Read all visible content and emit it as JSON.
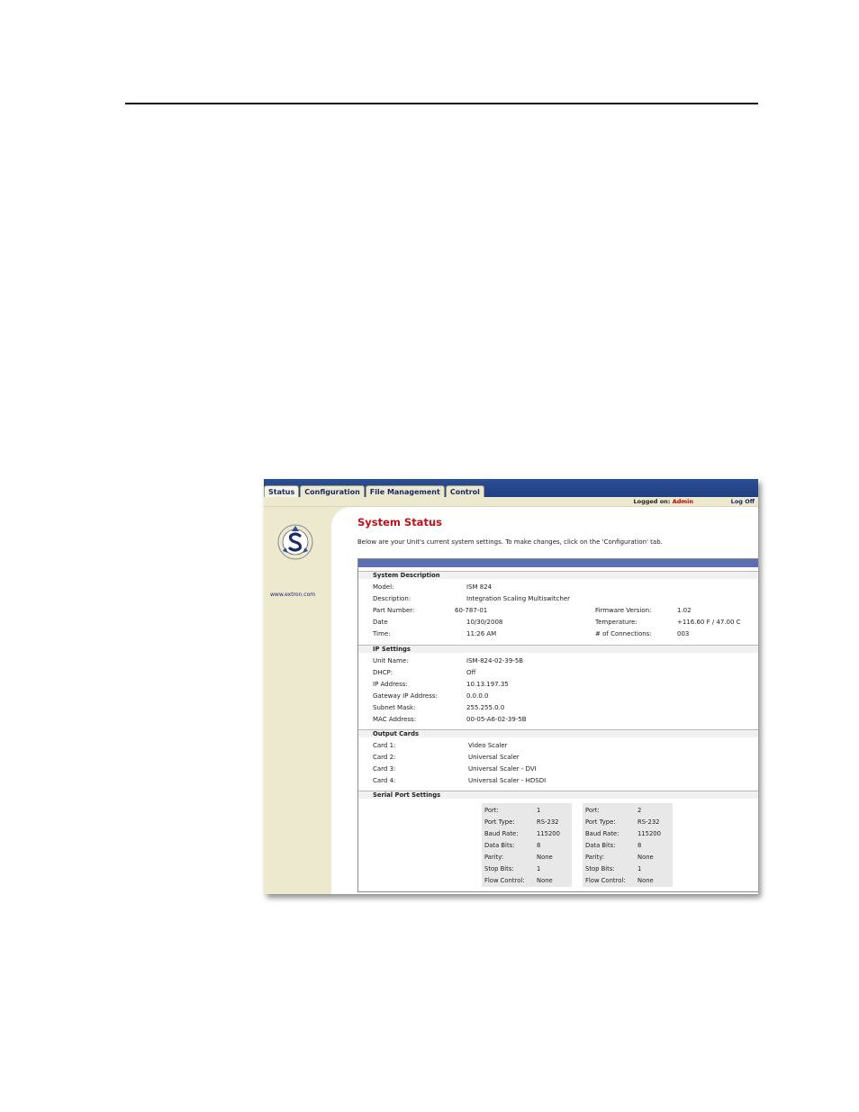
{
  "tabs": [
    "Status",
    "Configuration",
    "File Management",
    "Control"
  ],
  "header": {
    "logged_label": "Logged on:",
    "logged_user": "Admin",
    "logoff": "Log Off"
  },
  "sidebar": {
    "logo_url": "www.extron.com"
  },
  "main": {
    "title": "System Status",
    "intro": "Below are your Unit's current system settings. To make changes, click on the 'Configuration' tab."
  },
  "system_description": {
    "heading": "System Description",
    "left": [
      {
        "label": "Model:",
        "value": "ISM 824"
      },
      {
        "label": "Description:",
        "value": "Integration Scaling Multiswitcher"
      },
      {
        "label": "Part Number:",
        "value": "60-787-01"
      },
      {
        "label": "Date",
        "value": "10/30/2008"
      },
      {
        "label": "Time:",
        "value": "11:26 AM"
      }
    ],
    "right": [
      {
        "label": "Firmware Version:",
        "value": "1.02"
      },
      {
        "label": "Temperature:",
        "value": "+116.60 F / 47.00 C"
      },
      {
        "label": "# of Connections:",
        "value": "003"
      }
    ]
  },
  "ip_settings": {
    "heading": "IP Settings",
    "rows": [
      {
        "label": "Unit Name:",
        "value": "ISM-824-02-39-5B"
      },
      {
        "label": "DHCP:",
        "value": "Off"
      },
      {
        "label": "IP Address:",
        "value": "10.13.197.35"
      },
      {
        "label": "Gateway IP Address:",
        "value": "0.0.0.0"
      },
      {
        "label": "Subnet Mask:",
        "value": "255.255.0.0"
      },
      {
        "label": "MAC Address:",
        "value": "00-05-A6-02-39-5B"
      }
    ]
  },
  "output_cards": {
    "heading": "Output Cards",
    "rows": [
      {
        "label": "Card 1:",
        "value": "Video Scaler"
      },
      {
        "label": "Card 2:",
        "value": "Universal Scaler"
      },
      {
        "label": "Card 3:",
        "value": "Universal Scaler - DVI"
      },
      {
        "label": "Card 4:",
        "value": "Universal Scaler - HDSDI"
      }
    ]
  },
  "serial_ports": {
    "heading": "Serial Port Settings",
    "ports": [
      {
        "rows": [
          {
            "label": "Port:",
            "value": "1"
          },
          {
            "label": "Port Type:",
            "value": "RS-232"
          },
          {
            "label": "Baud Rate:",
            "value": "115200"
          },
          {
            "label": "Data Bits:",
            "value": "8"
          },
          {
            "label": "Parity:",
            "value": "None"
          },
          {
            "label": "Stop Bits:",
            "value": "1"
          },
          {
            "label": "Flow Control:",
            "value": "None"
          }
        ]
      },
      {
        "rows": [
          {
            "label": "Port:",
            "value": "2"
          },
          {
            "label": "Port Type:",
            "value": "RS-232"
          },
          {
            "label": "Baud Rate:",
            "value": "115200"
          },
          {
            "label": "Data Bits:",
            "value": "8"
          },
          {
            "label": "Parity:",
            "value": "None"
          },
          {
            "label": "Stop Bits:",
            "value": "1"
          },
          {
            "label": "Flow Control:",
            "value": "None"
          }
        ]
      }
    ]
  }
}
